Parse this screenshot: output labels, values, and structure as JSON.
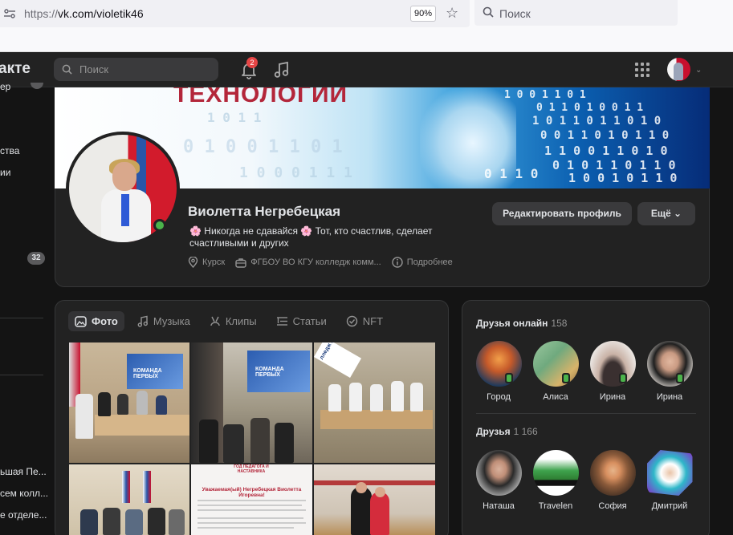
{
  "browser": {
    "url_proto": "https://",
    "url_rest": "vk.com/violetik46",
    "zoom": "90%",
    "search_placeholder": "Поиск",
    "icons": [
      "site-info-icon",
      "star-icon",
      "search-icon"
    ]
  },
  "vk_header": {
    "logo": "акте",
    "search_placeholder": "Поиск",
    "notifications_count": "2",
    "icons": [
      "bell-icon",
      "music-icon",
      "apps-grid-icon",
      "chevron-down-icon"
    ]
  },
  "sidebar": {
    "items": [
      "ер",
      "ства",
      "ии"
    ],
    "badge_count": "32",
    "bottom_items": [
      "ьшая Пе...",
      "сем колл...",
      "е отделе..."
    ]
  },
  "cover": {
    "title": "ТЕХНОЛОГИИ",
    "binary_lines": [
      "1 0 1 1",
      "0 1 0 0 1 1 0 1",
      "1 0 0 1 1 0 1",
      "0 1 1 0 1 0 0 1 1",
      "1 0 1 1 0 1 1 0 1 0",
      "0 0 1 1 0 1 0 1 1 0",
      "1 1 0 0 1 1 0 1 0",
      "0 1 0 1 1 0 1 1 0",
      "1 0 0 1 0 1 1 0",
      "1 0 0 0 1 1 1",
      "0 1 1 0"
    ]
  },
  "profile": {
    "name": "Виолетта Негребецкая",
    "status_flower": "🌸",
    "status_text_1": "Никогда не сдавайся",
    "status_text_2": "Тот, кто счастлив, сделает счастливыми и других",
    "city": "Курск",
    "work": "ФГБОУ ВО КГУ колледж комм...",
    "more_info": "Подробнее",
    "edit_button": "Редактировать профиль",
    "more_button": "Ещё"
  },
  "media_tabs": [
    {
      "label": "Фото",
      "icon": "photo-icon"
    },
    {
      "label": "Музыка",
      "icon": "music-icon"
    },
    {
      "label": "Клипы",
      "icon": "clips-icon"
    },
    {
      "label": "Статьи",
      "icon": "articles-icon"
    },
    {
      "label": "NFT",
      "icon": "nft-icon"
    }
  ],
  "photos": {
    "screen_label": "КОМАНДА ПЕРВЫХ",
    "banner_label": "лледж КГУ",
    "poster_header": "ГОД ПЕДАГОГА И НАСТАВНИКА",
    "poster_greeting": "Уважаемая(ый) Негребецкая Виолетта Игоревна!"
  },
  "friends_online": {
    "title": "Друзья онлайн",
    "count": "158",
    "items": [
      {
        "name": "Город",
        "color_a": "#c65a2a",
        "color_b": "#1f3a5c"
      },
      {
        "name": "Алиса",
        "color_a": "#6fa97e",
        "color_b": "#d7b36a"
      },
      {
        "name": "Ирина",
        "color_a": "#e9e4e0",
        "color_b": "#3a3030"
      },
      {
        "name": "Ирина",
        "color_a": "#e8e2dc",
        "color_b": "#1f1f1f"
      }
    ]
  },
  "friends": {
    "title": "Друзья",
    "count": "1 166",
    "items": [
      {
        "name": "Наташа",
        "color_a": "#d6d6d6",
        "color_b": "#2a2a2a"
      },
      {
        "name": "Travelen",
        "color_a": "#ffffff",
        "color_b": "#2e7d32"
      },
      {
        "name": "София",
        "color_a": "#8a5a3a",
        "color_b": "#d89060"
      },
      {
        "name": "Дмитрий",
        "color_a": "#2fb7c9",
        "color_b": "#7b3fc9"
      }
    ]
  }
}
